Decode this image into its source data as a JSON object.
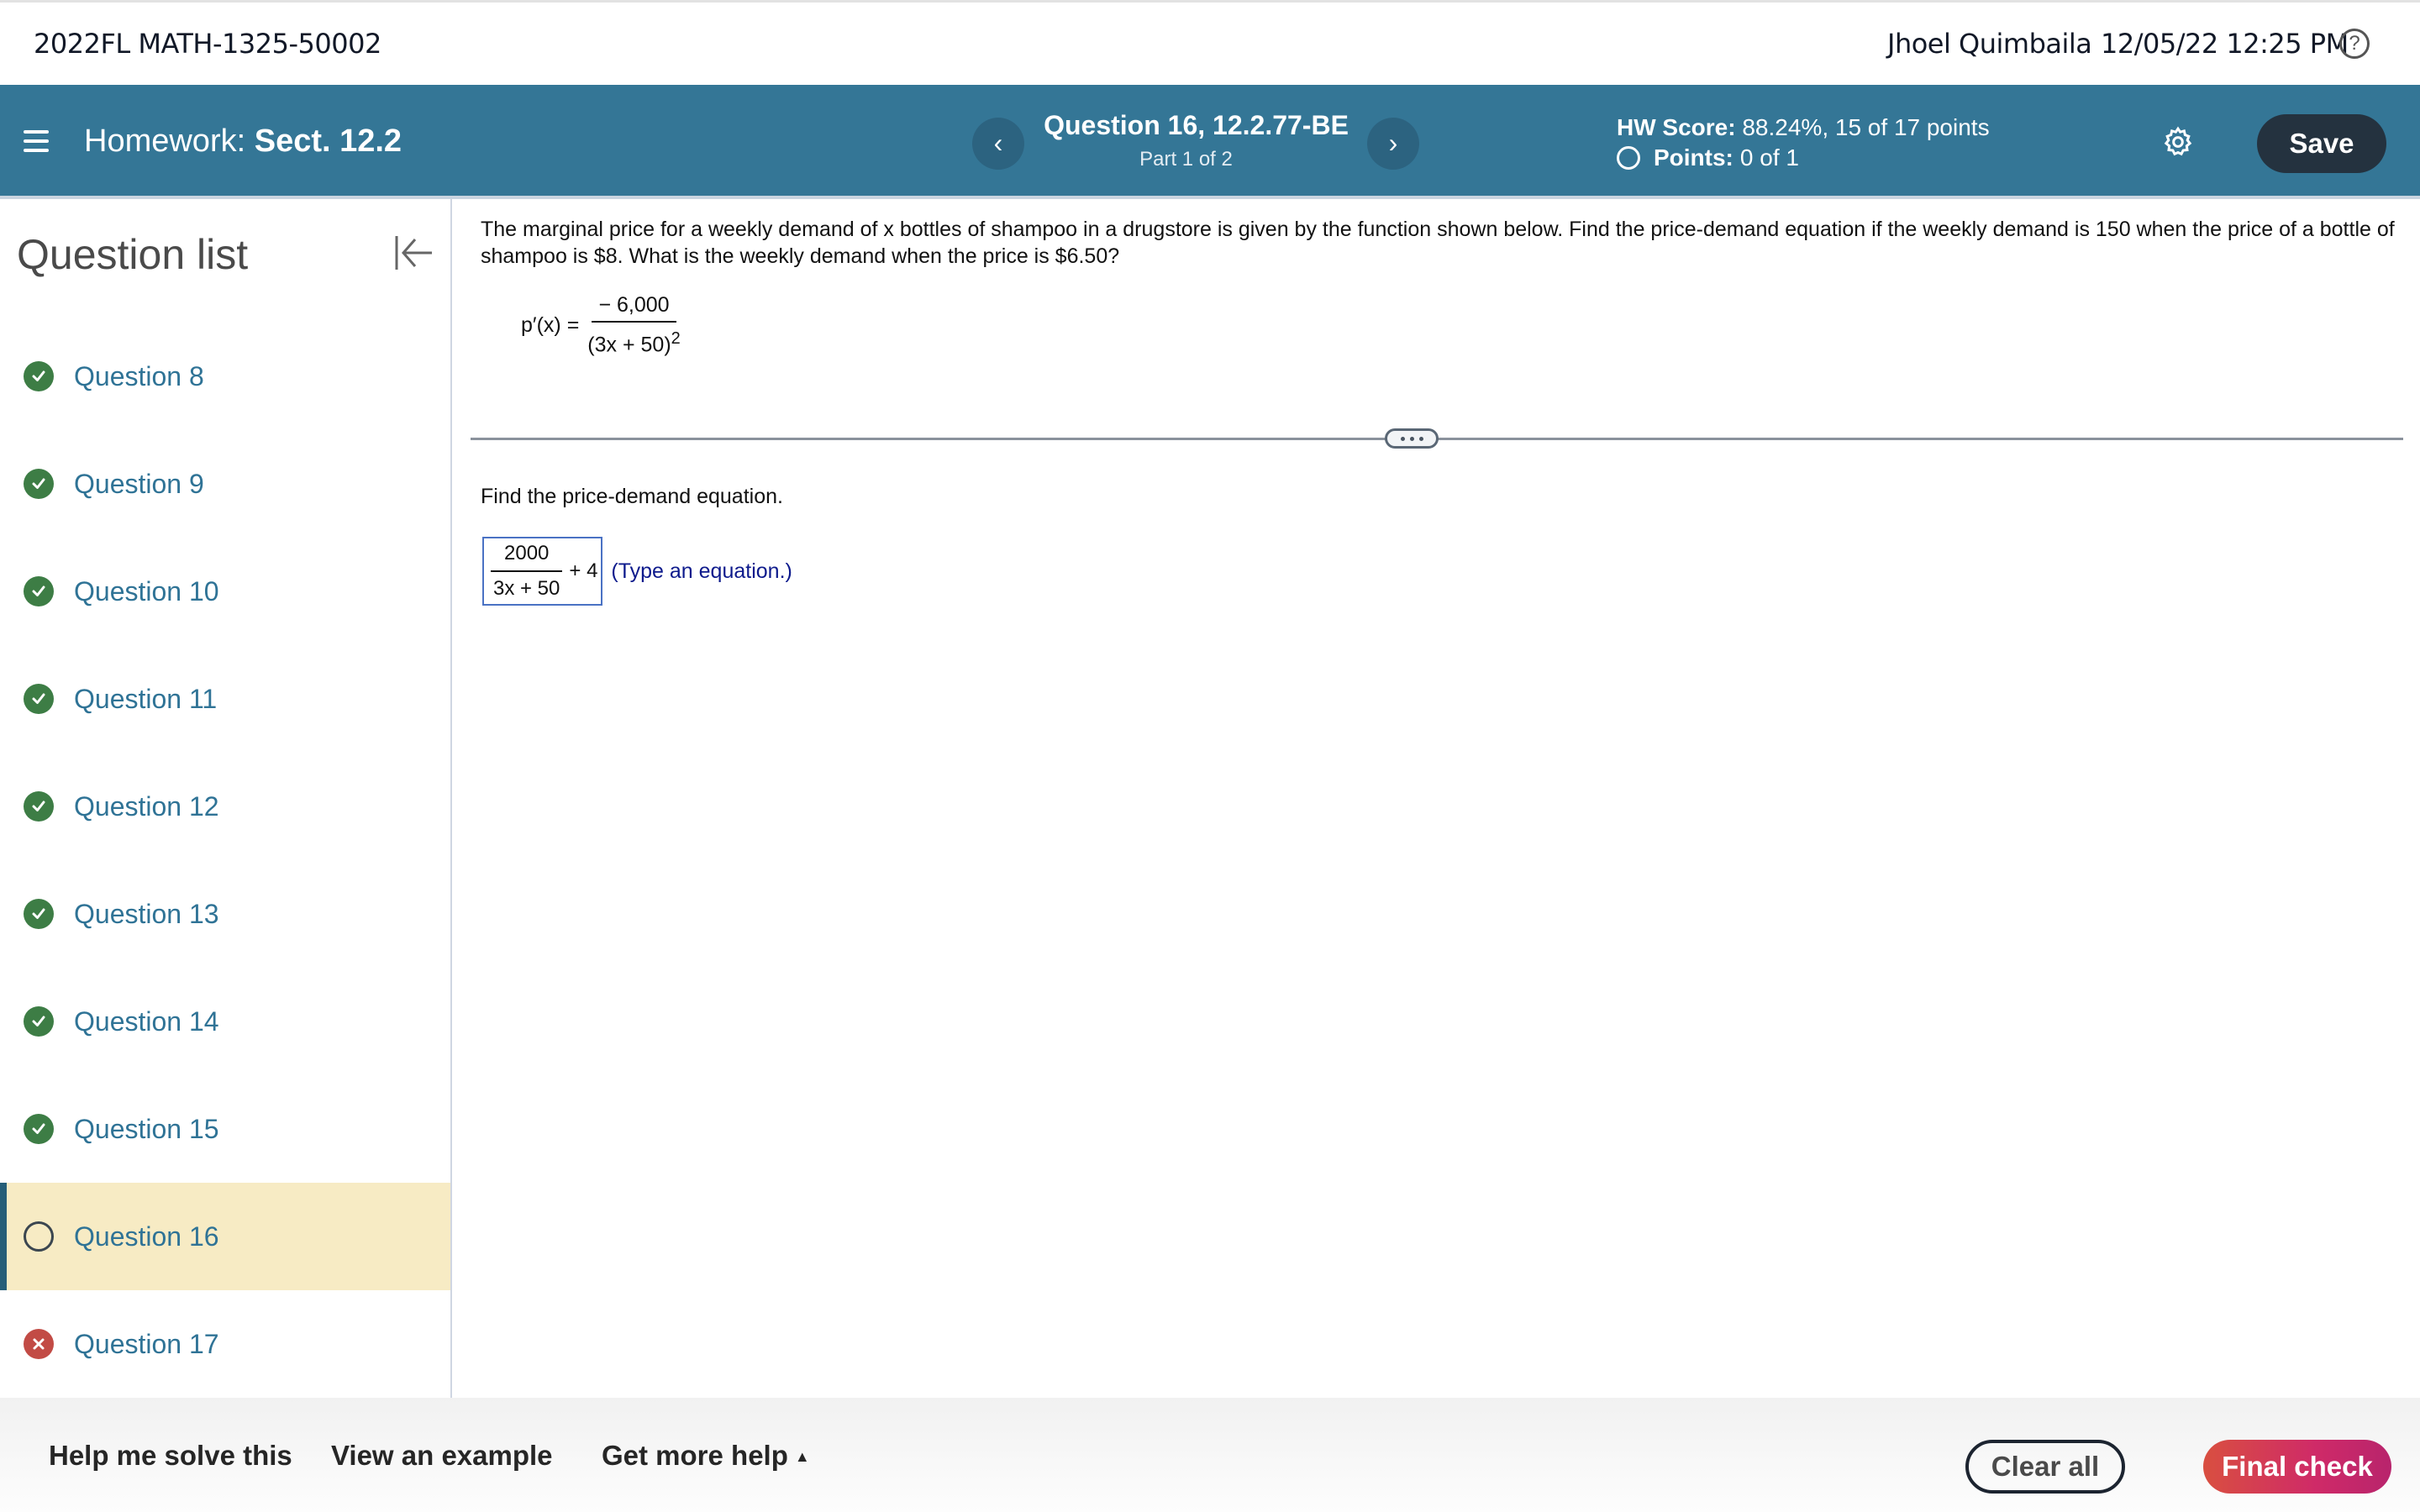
{
  "topbar": {
    "course": "2022FL MATH-1325-50002",
    "user": "Jhoel Quimbaila",
    "datetime": "12/05/22 12:25 PM",
    "help_icon": "?"
  },
  "header": {
    "homework_prefix": "Homework:",
    "homework_name": "Sect. 12.2",
    "prev_icon": "‹",
    "next_icon": "›",
    "question_title": "Question 16, 12.2.77-BE",
    "question_part": "Part 1 of 2",
    "score_label": "HW Score:",
    "score_value": "88.24%, 15 of 17 points",
    "points_label": "Points:",
    "points_value": "0 of 1",
    "save_label": "Save",
    "colors": {
      "header_bg": "#347696",
      "save_bg": "#24323f"
    }
  },
  "sidebar": {
    "title": "Question list",
    "items": [
      {
        "label": "Question 8",
        "status": "correct"
      },
      {
        "label": "Question 9",
        "status": "correct"
      },
      {
        "label": "Question 10",
        "status": "correct"
      },
      {
        "label": "Question 11",
        "status": "correct"
      },
      {
        "label": "Question 12",
        "status": "correct"
      },
      {
        "label": "Question 13",
        "status": "correct"
      },
      {
        "label": "Question 14",
        "status": "correct"
      },
      {
        "label": "Question 15",
        "status": "correct"
      },
      {
        "label": "Question 16",
        "status": "current"
      },
      {
        "label": "Question 17",
        "status": "incorrect"
      }
    ]
  },
  "question": {
    "prompt": "The marginal price for a weekly demand of x bottles of shampoo in a drugstore is given by the function shown below. Find the price-demand equation if the weekly demand is 150 when the price of a bottle of shampoo is $8. What is the weekly demand when the price is $6.50?",
    "formula_lhs": "p′(x) =",
    "formula_num": "− 6,000",
    "formula_den": "(3x + 50)",
    "formula_exp": "2",
    "sub_prompt": "Find the price-demand equation.",
    "answer_num": "2000",
    "answer_den": "3x + 50",
    "answer_tail": "+ 4",
    "answer_hint": "(Type an equation.)"
  },
  "bottom": {
    "help_solve": "Help me solve this",
    "view_example": "View an example",
    "more_help": "Get more help",
    "more_help_icon": "▲",
    "clear_all": "Clear all",
    "final_check": "Final check"
  }
}
